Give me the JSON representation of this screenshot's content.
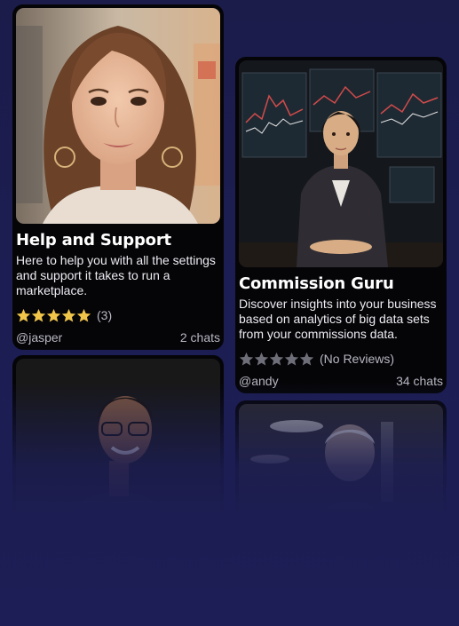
{
  "cards": [
    {
      "title": "Help and Support",
      "description": "Here to help you with all the settings and support it takes to run a marketplace.",
      "rating": 5,
      "reviews_label": "(3)",
      "author": "@jasper",
      "chats": "2 chats",
      "star_color": "#f0c54a"
    },
    {
      "title": "Commission Guru",
      "description": "Discover insights into your business based on analytics of big data sets from your commissions data.",
      "rating": 0,
      "reviews_label": "(No Reviews)",
      "author": "@andy",
      "chats": "34 chats",
      "star_color": "#6e6e78"
    }
  ]
}
